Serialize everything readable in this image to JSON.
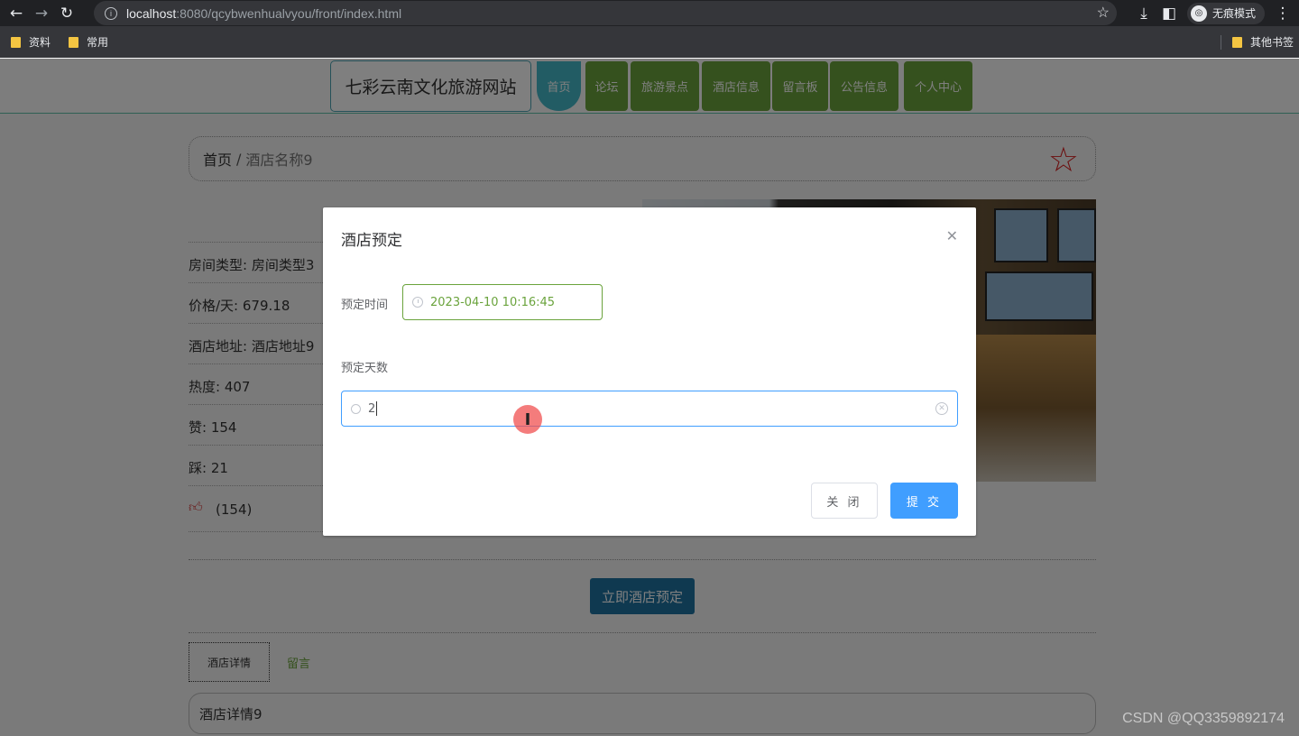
{
  "browser": {
    "url_host": "localhost",
    "url_path": ":8080/qcybwenhualvyou/front/index.html",
    "incognito_label": "无痕模式",
    "bookmarks": [
      "资料",
      "常用"
    ],
    "other_bookmarks": "其他书签"
  },
  "site": {
    "logo": "七彩云南文化旅游网站",
    "nav": [
      "首页",
      "论坛",
      "旅游景点",
      "酒店信息",
      "留言板",
      "公告信息",
      "个人中心"
    ]
  },
  "breadcrumb": {
    "home": "首页",
    "sep": "/",
    "current": "酒店名称9"
  },
  "hotel": {
    "room_type": "房间类型: 房间类型3",
    "price": "价格/天: 679.18",
    "address": "酒店地址: 酒店地址9",
    "heat": "热度: 407",
    "likes": "赞: 154",
    "dislikes": "踩: 21",
    "thumb_count": "(154)"
  },
  "book_button": "立即酒店预定",
  "tabs": [
    "酒店详情",
    "留言"
  ],
  "detail_text": "酒店详情9",
  "dialog": {
    "title": "酒店预定",
    "time_label": "预定时间",
    "time_value": "2023-04-10 10:16:45",
    "days_label": "预定天数",
    "days_value": "2",
    "close_button": "关 闭",
    "submit_button": "提 交"
  },
  "watermark": "CSDN @QQ3359892174"
}
